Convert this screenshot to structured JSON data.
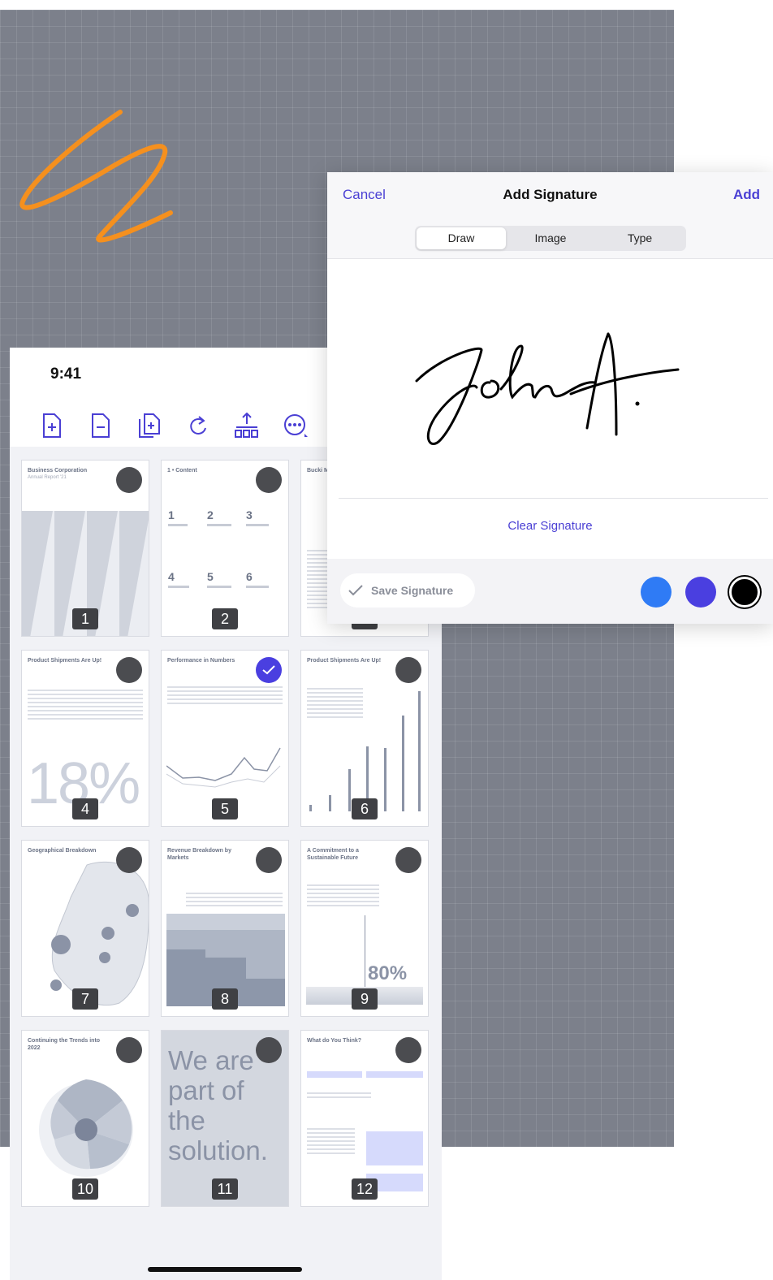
{
  "phone": {
    "time": "9:41",
    "toolbar": [
      "add-page-icon",
      "remove-page-icon",
      "duplicate-page-icon",
      "rotate-icon",
      "split-icon",
      "more-icon"
    ],
    "pages": [
      {
        "number": "1",
        "title": "Business Corporation",
        "sub": "Annual Report '21",
        "selected": false
      },
      {
        "number": "2",
        "title": "1 • Content",
        "sub": "",
        "selected": false
      },
      {
        "number": "3",
        "title": "Bucki Marke",
        "sub": "",
        "selected": false
      },
      {
        "number": "4",
        "title": "Product Shipments Are Up!",
        "sub": "18%",
        "selected": false
      },
      {
        "number": "5",
        "title": "Performance in Numbers",
        "sub": "",
        "selected": true
      },
      {
        "number": "6",
        "title": "Product Shipments Are Up!",
        "sub": "",
        "selected": false
      },
      {
        "number": "7",
        "title": "Geographical Breakdown",
        "sub": "",
        "selected": false
      },
      {
        "number": "8",
        "title": "Revenue Breakdown by Markets",
        "sub": "",
        "selected": false
      },
      {
        "number": "9",
        "title": "A Commitment to a Sustainable Future",
        "sub": "80%",
        "selected": false
      },
      {
        "number": "10",
        "title": "Continuing the Trends into 2022",
        "sub": "",
        "selected": false
      },
      {
        "number": "11",
        "title": "We are part of the solution.",
        "sub": "",
        "selected": false
      },
      {
        "number": "12",
        "title": "What do You Think?",
        "sub": "",
        "selected": false
      }
    ]
  },
  "dialog": {
    "cancel": "Cancel",
    "title": "Add Signature",
    "add": "Add",
    "tabs": [
      "Draw",
      "Image",
      "Type"
    ],
    "active_tab": "Draw",
    "clear": "Clear Signature",
    "save": "Save Signature",
    "colors": [
      "#2f7bf5",
      "#4a3fe0",
      "#000000"
    ],
    "selected_color": "#000000"
  },
  "colors": {
    "accent": "#4a3fd4",
    "squiggle": "#f5901e",
    "canvas": "#7c808b"
  }
}
